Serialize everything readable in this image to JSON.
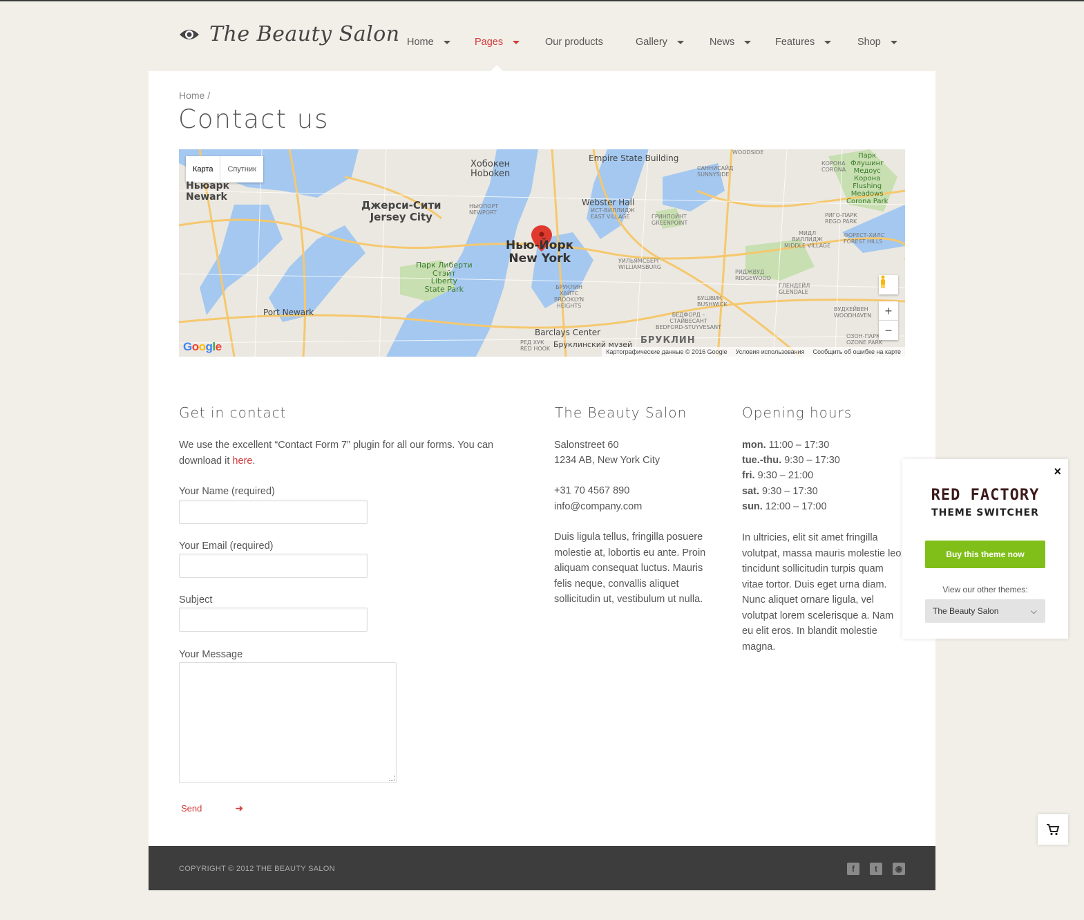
{
  "header": {
    "logo_text": "The Beauty Salon",
    "nav": [
      {
        "label": "Home",
        "has_dropdown": true,
        "active": false
      },
      {
        "label": "Pages",
        "has_dropdown": true,
        "active": true
      },
      {
        "label": "Our products",
        "has_dropdown": false,
        "active": false
      },
      {
        "label": "Gallery",
        "has_dropdown": true,
        "active": false
      },
      {
        "label": "News",
        "has_dropdown": true,
        "active": false
      },
      {
        "label": "Features",
        "has_dropdown": true,
        "active": false
      },
      {
        "label": "Shop",
        "has_dropdown": true,
        "active": false
      }
    ]
  },
  "breadcrumb": "Home /",
  "page_title": "Contact us",
  "map": {
    "type_buttons": [
      "Карта",
      "Спутник"
    ],
    "labels": {
      "newark": "Ньюарк\nNewark",
      "jersey_city": "Джерси-Сити\nJersey City",
      "hoboken": "Хобокен\nHoboken",
      "new_york": "Нью-Йорк\nNew York",
      "empire": "Empire State Building",
      "webster": "Webster Hall",
      "port_newark": "Port Newark",
      "liberty": "Парк Либерти\nСтэйт\nLiberty\nState Park",
      "barclays": "Barclays Center",
      "brooklyn_museum": "Бруклинский музей",
      "brooklyn": "БРУКЛИН",
      "flushing": "Парк\nФлушинг\nМедоус\nКорона\nFlushing\nMeadows\nCorona Park",
      "greenpoint": "ГРИНПОЙНТ\nGREENPOINT",
      "williamsburg": "УИЛЬЯМСБЕРГ\nWILLIAMSBURG",
      "ridgewood": "РИДЖВУД\nRIDGEWOOD",
      "bushwick": "БУШВИК\nBUSHWICK",
      "middle_village": "МИДЛ\nВИЛЛИДЖ\nMIDDLE VILLAGE",
      "rego_park": "РИГО-ПАРК\nREGO PARK",
      "forest_hills": "ФОРЕСТ-ХИЛС\nFOREST HILLS",
      "glendale": "ГЛЕНДЕЙЛ\nGLENDALE",
      "woodhaven": "ВУДХЕЙВЕН\nWOODHAVEN",
      "ozone_park": "ОЗОН-ПАРК\nOZONE PARK",
      "sunnyside": "САННИСАЙД\nSUNNYSIDE",
      "corona": "КОРОНА\nCORONA",
      "woodside": "WOODSIDE",
      "east_village": "ИСТ-ВИЛЛИДЖ\nEAST VILLAGE",
      "newport": "НЬЮПОРТ\nNEWPORT",
      "red_hook": "РЕД ХУК\nRED HOOK",
      "brooklyn_heights": "БРУКЛИН\nХАЙТС\nBROOKLYN\nHEIGHTS",
      "bed_stuy": "БЕДФОРД –\nСТАЙВЕСАНТ\nBEDFORD-STUYVESANT"
    },
    "google_logo": "Google",
    "attribution": [
      "Картографические данные © 2016 Google",
      "Условия использования",
      "Сообщить об ошибке на карте"
    ],
    "zoom_in": "+",
    "zoom_out": "−"
  },
  "contact": {
    "heading": "Get in contact",
    "intro_before_link": "We use the excellent “Contact Form 7” plugin for all our forms. You can download it ",
    "intro_link": "here",
    "intro_after_link": ".",
    "fields": {
      "name_label": "Your Name (required)",
      "email_label": "Your Email (required)",
      "subject_label": "Subject",
      "message_label": "Your Message"
    },
    "send_label": "Send"
  },
  "salon": {
    "heading": "The Beauty Salon",
    "address_line1": "Salonstreet 60",
    "address_line2": "1234 AB, New York City",
    "phone": "+31 70 4567 890",
    "email": "info@company.com",
    "description": "Duis ligula tellus, fringilla posuere molestie at, lobortis eu ante. Proin aliquam consequat luctus. Mauris felis neque, convallis aliquet sollicitudin ut, vestibulum ut nulla."
  },
  "hours": {
    "heading": "Opening hours",
    "rows": [
      {
        "day": "mon.",
        "time": "11:00 – 17:30"
      },
      {
        "day": "tue.-thu.",
        "time": "9:30 – 17:30"
      },
      {
        "day": "fri.",
        "time": "9:30 – 21:00"
      },
      {
        "day": "sat.",
        "time": "9:30 – 17:30"
      },
      {
        "day": "sun.",
        "time": "12:00 – 17:00"
      }
    ],
    "description": "In ultricies, elit sit amet fringilla volutpat, massa mauris molestie leo, tincidunt sollicitudin turpis quam vitae tortor. Duis eget urna diam. Nunc aliquet ornare ligula, vel volutpat lorem scelerisque a. Nam eu elit eros. In blandit molestie magna."
  },
  "footer": {
    "copyright": "COPYRIGHT © 2012 THE BEAUTY SALON",
    "socials": [
      "facebook-icon",
      "twitter-icon",
      "rss-icon"
    ]
  },
  "switcher": {
    "brand_line1": "RED FACTORY",
    "brand_line2": "THEME SWITCHER",
    "buy_label": "Buy this theme now",
    "view_label": "View our other themes:",
    "selected_theme": "The Beauty Salon",
    "close_label": "×"
  },
  "colors": {
    "accent": "#d23a3a",
    "buy_button": "#80bf19",
    "background": "#f2efe8",
    "footer": "#3d3d3d"
  }
}
